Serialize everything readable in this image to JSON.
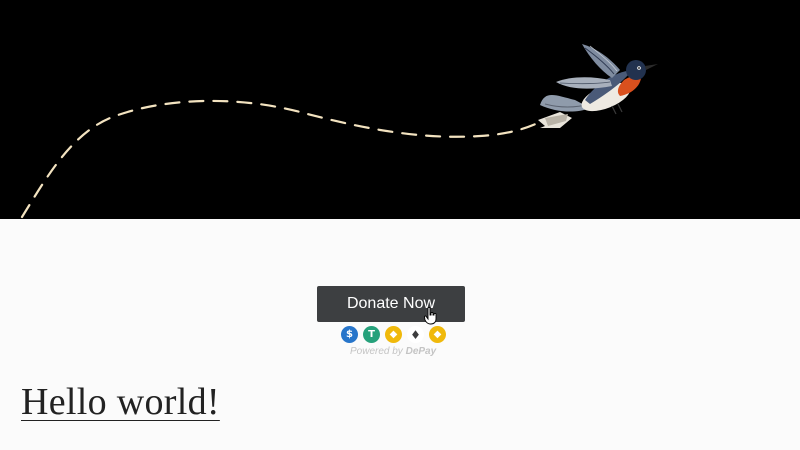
{
  "hero": {
    "background": "#000000",
    "path_color": "#f3e3c0",
    "illustration": "flying-bird"
  },
  "donation": {
    "button_label": "Donate Now",
    "cursor_icon": "hand-pointer",
    "tokens": [
      {
        "name": "USDC",
        "icon": "usdc-icon",
        "color": "#2775ca",
        "glyph": "$"
      },
      {
        "name": "USDT",
        "icon": "tether-icon",
        "color": "#26a17b",
        "glyph": "T"
      },
      {
        "name": "BUSD",
        "icon": "busd-icon",
        "color": "#f0b90b",
        "glyph": "◆"
      },
      {
        "name": "ETH",
        "icon": "ethereum-icon",
        "color": "#ffffff",
        "glyph": "♦"
      },
      {
        "name": "BNB",
        "icon": "bnb-icon",
        "color": "#f0b90b",
        "glyph": "◆"
      }
    ],
    "powered_by_prefix": "Powered by",
    "powered_by_brand": "DePay"
  },
  "headline": {
    "text": "Hello world!"
  }
}
